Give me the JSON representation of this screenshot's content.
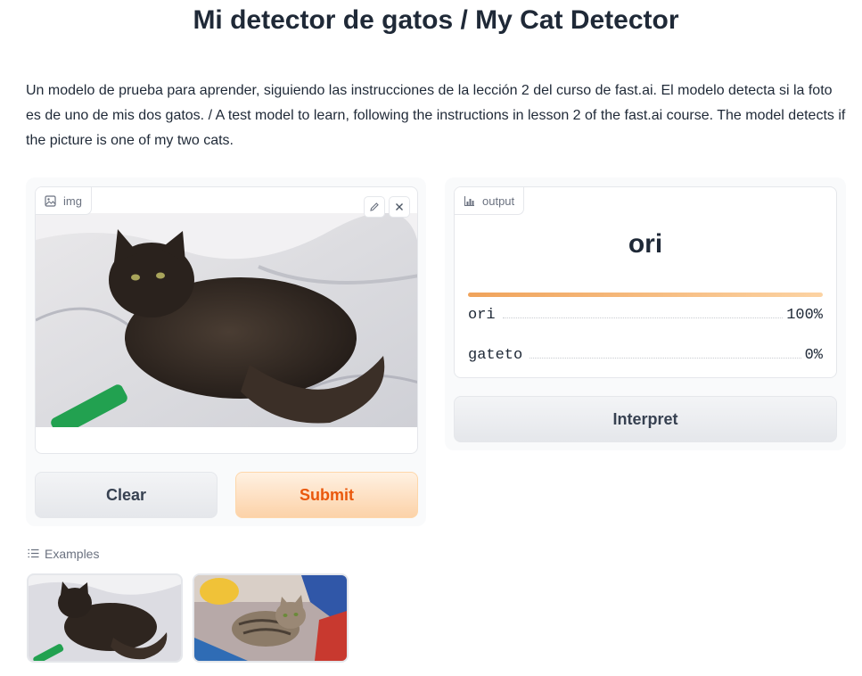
{
  "page": {
    "title": "Mi detector de gatos / My Cat Detector",
    "description": "Un modelo de prueba para aprender, siguiendo las instrucciones de la lección 2 del curso de fast.ai. El modelo detecta si la foto es de uno de mis dos gatos. / A test model to learn, following the instructions in lesson 2 of the fast.ai course. The model detects if the picture is one of my two cats."
  },
  "input": {
    "label": "img",
    "icon": "image-icon",
    "edit_icon": "pencil-icon",
    "close_icon": "close-icon"
  },
  "output": {
    "label": "output",
    "icon": "bar-chart-icon",
    "top_label": "ori",
    "confidences": [
      {
        "label": "ori",
        "value": "100%",
        "fraction": 1.0
      },
      {
        "label": "gateto",
        "value": "0%",
        "fraction": 0.0
      }
    ]
  },
  "buttons": {
    "clear": "Clear",
    "submit": "Submit",
    "interpret": "Interpret"
  },
  "examples": {
    "label": "Examples",
    "icon": "list-icon"
  },
  "colors": {
    "accent": "#ea580c",
    "submit_bg": "#fcd2a8",
    "bar_start": "#f0a35b",
    "bar_end": "#fcd3a3"
  }
}
